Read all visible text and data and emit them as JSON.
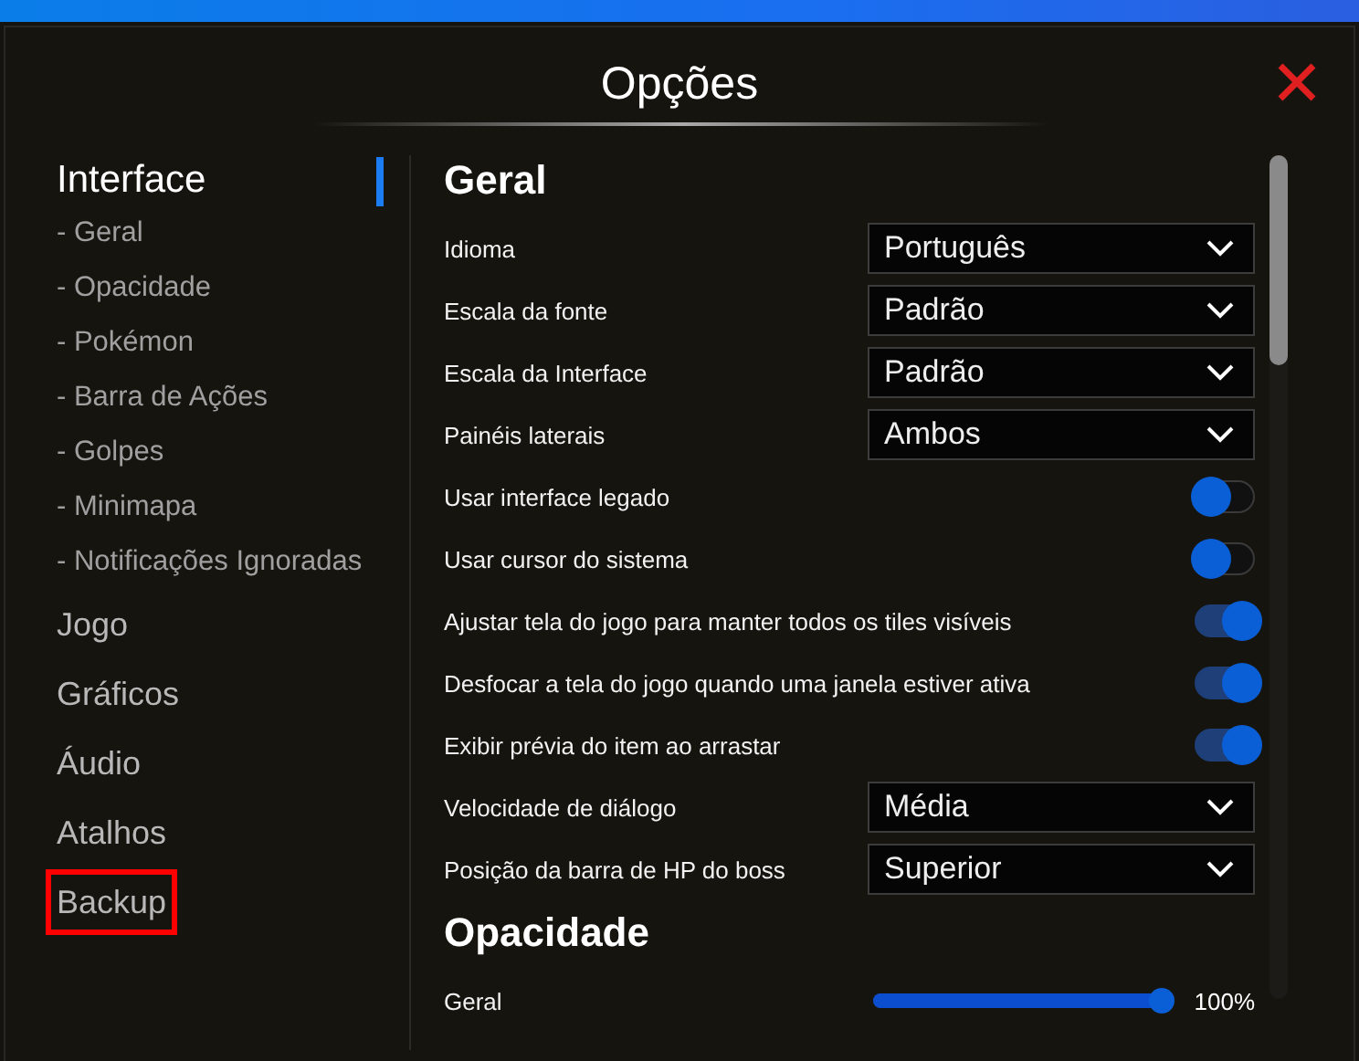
{
  "window": {
    "title": "Opções"
  },
  "sidebar": {
    "sections": [
      {
        "label": "Interface",
        "selected": true,
        "highlighted": false,
        "children": [
          {
            "label": "- Geral"
          },
          {
            "label": "- Opacidade"
          },
          {
            "label": "- Pokémon"
          },
          {
            "label": "- Barra de Ações"
          },
          {
            "label": "- Golpes"
          },
          {
            "label": "- Minimapa"
          },
          {
            "label": "- Notificações Ignoradas"
          }
        ]
      },
      {
        "label": "Jogo",
        "selected": false,
        "highlighted": false
      },
      {
        "label": "Gráficos",
        "selected": false,
        "highlighted": false
      },
      {
        "label": "Áudio",
        "selected": false,
        "highlighted": false
      },
      {
        "label": "Atalhos",
        "selected": false,
        "highlighted": false
      },
      {
        "label": "Backup",
        "selected": false,
        "highlighted": true
      }
    ]
  },
  "content": {
    "sections": [
      {
        "title": "Geral",
        "rows": [
          {
            "kind": "dropdown",
            "label": "Idioma",
            "value": "Português"
          },
          {
            "kind": "dropdown",
            "label": "Escala da fonte",
            "value": "Padrão"
          },
          {
            "kind": "dropdown",
            "label": "Escala da Interface",
            "value": "Padrão"
          },
          {
            "kind": "dropdown",
            "label": "Painéis laterais",
            "value": "Ambos"
          },
          {
            "kind": "toggle",
            "label": "Usar interface legado",
            "on": false
          },
          {
            "kind": "toggle",
            "label": "Usar cursor do sistema",
            "on": false
          },
          {
            "kind": "toggle",
            "label": "Ajustar tela do jogo para manter todos os tiles visíveis",
            "on": true
          },
          {
            "kind": "toggle",
            "label": "Desfocar a tela do jogo quando uma janela estiver ativa",
            "on": true
          },
          {
            "kind": "toggle",
            "label": "Exibir prévia do item ao arrastar",
            "on": true
          },
          {
            "kind": "dropdown",
            "label": "Velocidade de diálogo",
            "value": "Média"
          },
          {
            "kind": "dropdown",
            "label": "Posição da barra de HP do boss",
            "value": "Superior"
          }
        ]
      },
      {
        "title": "Opacidade",
        "rows": [
          {
            "kind": "slider",
            "label": "Geral",
            "level": 1.0,
            "reading": "100%"
          }
        ]
      }
    ]
  }
}
